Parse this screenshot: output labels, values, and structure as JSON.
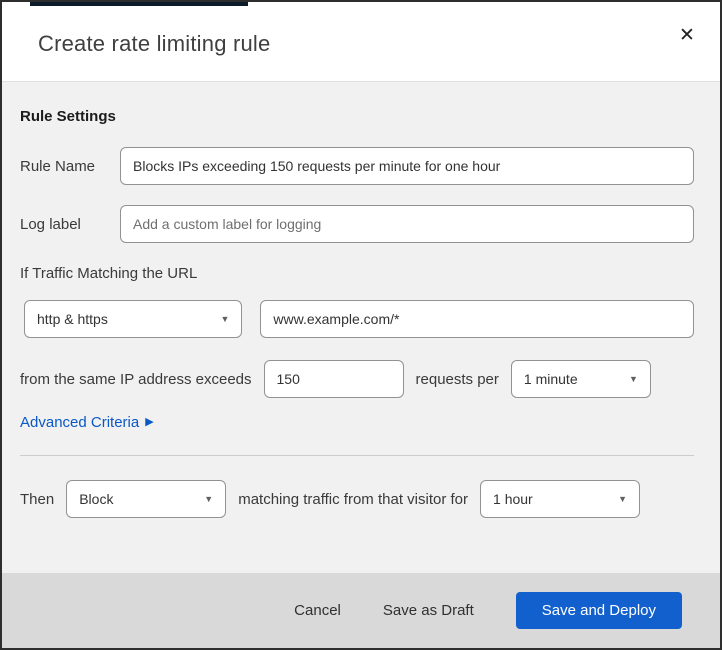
{
  "modal": {
    "title": "Create rate limiting rule",
    "close_glyph": "✕"
  },
  "form": {
    "section_heading": "Rule Settings",
    "rule_name": {
      "label": "Rule Name",
      "value": "Blocks IPs exceeding 150 requests per minute for one hour"
    },
    "log_label": {
      "label": "Log label",
      "placeholder": "Add a custom label for logging"
    },
    "traffic_match": {
      "heading": "If Traffic Matching the URL",
      "scheme_selected": "http & https",
      "url_value": "www.example.com/*"
    },
    "threshold": {
      "prefix": "from the same IP address exceeds",
      "requests_value": "150",
      "middle": "requests per",
      "period_selected": "1 minute"
    },
    "advanced": {
      "label": "Advanced Criteria",
      "arrow_glyph": "▶"
    },
    "then": {
      "prefix": "Then",
      "action_selected": "Block",
      "middle": "matching traffic from that visitor for",
      "duration_selected": "1 hour"
    },
    "caret_glyph": "▼"
  },
  "footer": {
    "cancel_label": "Cancel",
    "save_draft_label": "Save as Draft",
    "save_deploy_label": "Save and Deploy"
  },
  "colors": {
    "accent_link_blue": "#0a58c6",
    "primary_button_blue": "#1160cd",
    "top_peek_navy": "#0c1c2b"
  }
}
